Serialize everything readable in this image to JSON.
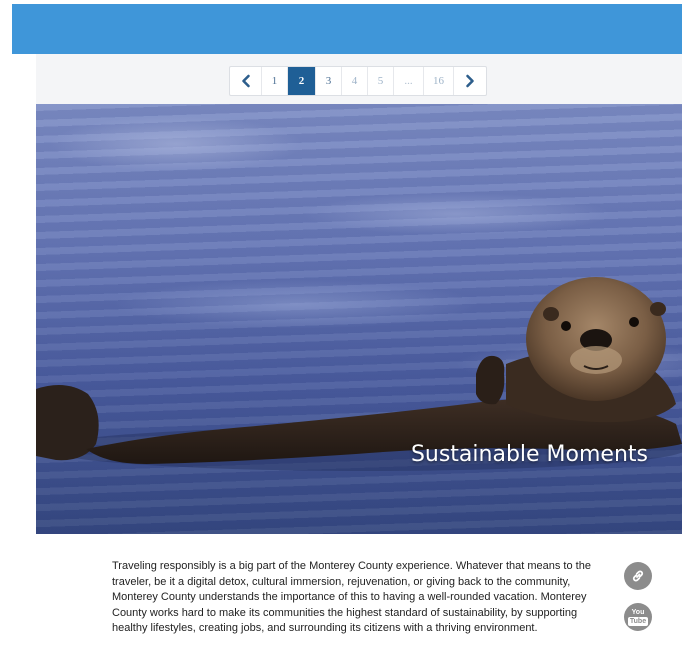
{
  "pagination": {
    "prev_icon": "chevron-left-icon",
    "next_icon": "chevron-right-icon",
    "pages": [
      "1",
      "2",
      "3",
      "4",
      "5",
      "...",
      "16"
    ],
    "active_page": "2"
  },
  "hero": {
    "title": "Sustainable Moments"
  },
  "content": {
    "paragraph": "Traveling responsibly is a big part of the Monterey County experience. Whatever that means to the traveler, be it a digital detox, cultural immersion, rejuvenation, or giving back to the community, Monterey County understands the importance of this to having a well-rounded vacation. Monterey County works hard to make its communities the highest standard of sustainability, by supporting healthy lifestyles, creating jobs, and surrounding its citizens with a thriving environment."
  },
  "social": {
    "link_icon": "link-icon",
    "youtube_icon": "youtube-icon",
    "youtube_top": "You",
    "youtube_bottom": "Tube"
  },
  "colors": {
    "topbar": "#3f96d9",
    "active_page": "#1f5f96",
    "social_icon": "#8c8c8c"
  }
}
